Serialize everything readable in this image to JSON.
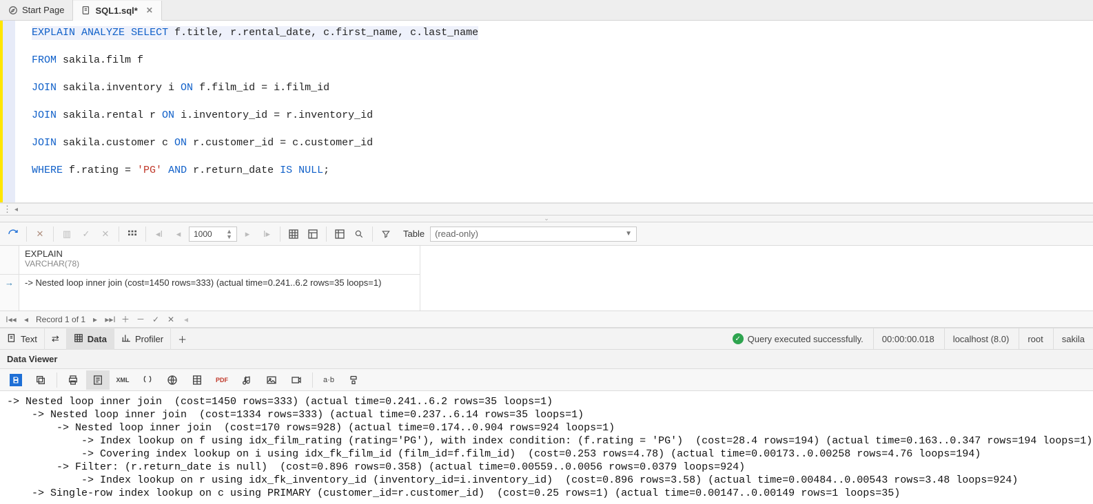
{
  "tabs": {
    "start": "Start Page",
    "sql": "SQL1.sql*"
  },
  "sql": {
    "l1_kw1": "EXPLAIN",
    "l1_kw2": "ANALYZE",
    "l1_kw3": "SELECT",
    "l1_rest": " f.title, r.rental_date, c.first_name, c.last_name",
    "l2_kw": "FROM",
    "l2_rest": " sakila.film f",
    "l3_kw1": "JOIN",
    "l3_mid": " sakila.inventory i ",
    "l3_kw2": "ON",
    "l3_rest": " f.film_id = i.film_id",
    "l4_kw1": "JOIN",
    "l4_mid": " sakila.rental r ",
    "l4_kw2": "ON",
    "l4_rest": " i.inventory_id = r.inventory_id",
    "l5_kw1": "JOIN",
    "l5_mid": " sakila.customer c ",
    "l5_kw2": "ON",
    "l5_rest": " r.customer_id = c.customer_id",
    "l6_kw1": "WHERE",
    "l6_a": " f.rating = ",
    "l6_str": "'PG'",
    "l6_kw2": " AND",
    "l6_b": " r.return_date ",
    "l6_kw3": "IS NULL",
    "l6_end": ";"
  },
  "toolbar": {
    "count": "1000",
    "table_label": "Table",
    "readonly": "(read-only)"
  },
  "grid": {
    "col_name": "EXPLAIN",
    "col_type": "VARCHAR(78)",
    "row1": "-> Nested loop inner join  (cost=1450 rows=333) (actual time=0.241..6.2 rows=35 loops=1)"
  },
  "nav": {
    "record": "Record 1 of 1"
  },
  "bottom_tabs": {
    "text": "Text",
    "data": "Data",
    "profiler": "Profiler"
  },
  "status": {
    "msg": "Query executed successfully.",
    "time": "00:00:00.018",
    "host": "localhost (8.0)",
    "user": "root",
    "schema": "sakila"
  },
  "viewer": {
    "title": "Data Viewer",
    "abv": "a·b",
    "lines": [
      "-> Nested loop inner join  (cost=1450 rows=333) (actual time=0.241..6.2 rows=35 loops=1)",
      "    -> Nested loop inner join  (cost=1334 rows=333) (actual time=0.237..6.14 rows=35 loops=1)",
      "        -> Nested loop inner join  (cost=170 rows=928) (actual time=0.174..0.904 rows=924 loops=1)",
      "            -> Index lookup on f using idx_film_rating (rating='PG'), with index condition: (f.rating = 'PG')  (cost=28.4 rows=194) (actual time=0.163..0.347 rows=194 loops=1)",
      "            -> Covering index lookup on i using idx_fk_film_id (film_id=f.film_id)  (cost=0.253 rows=4.78) (actual time=0.00173..0.00258 rows=4.76 loops=194)",
      "        -> Filter: (r.return_date is null)  (cost=0.896 rows=0.358) (actual time=0.00559..0.0056 rows=0.0379 loops=924)",
      "            -> Index lookup on r using idx_fk_inventory_id (inventory_id=i.inventory_id)  (cost=0.896 rows=3.58) (actual time=0.00484..0.00543 rows=3.48 loops=924)",
      "    -> Single-row index lookup on c using PRIMARY (customer_id=r.customer_id)  (cost=0.25 rows=1) (actual time=0.00147..0.00149 rows=1 loops=35)"
    ]
  }
}
